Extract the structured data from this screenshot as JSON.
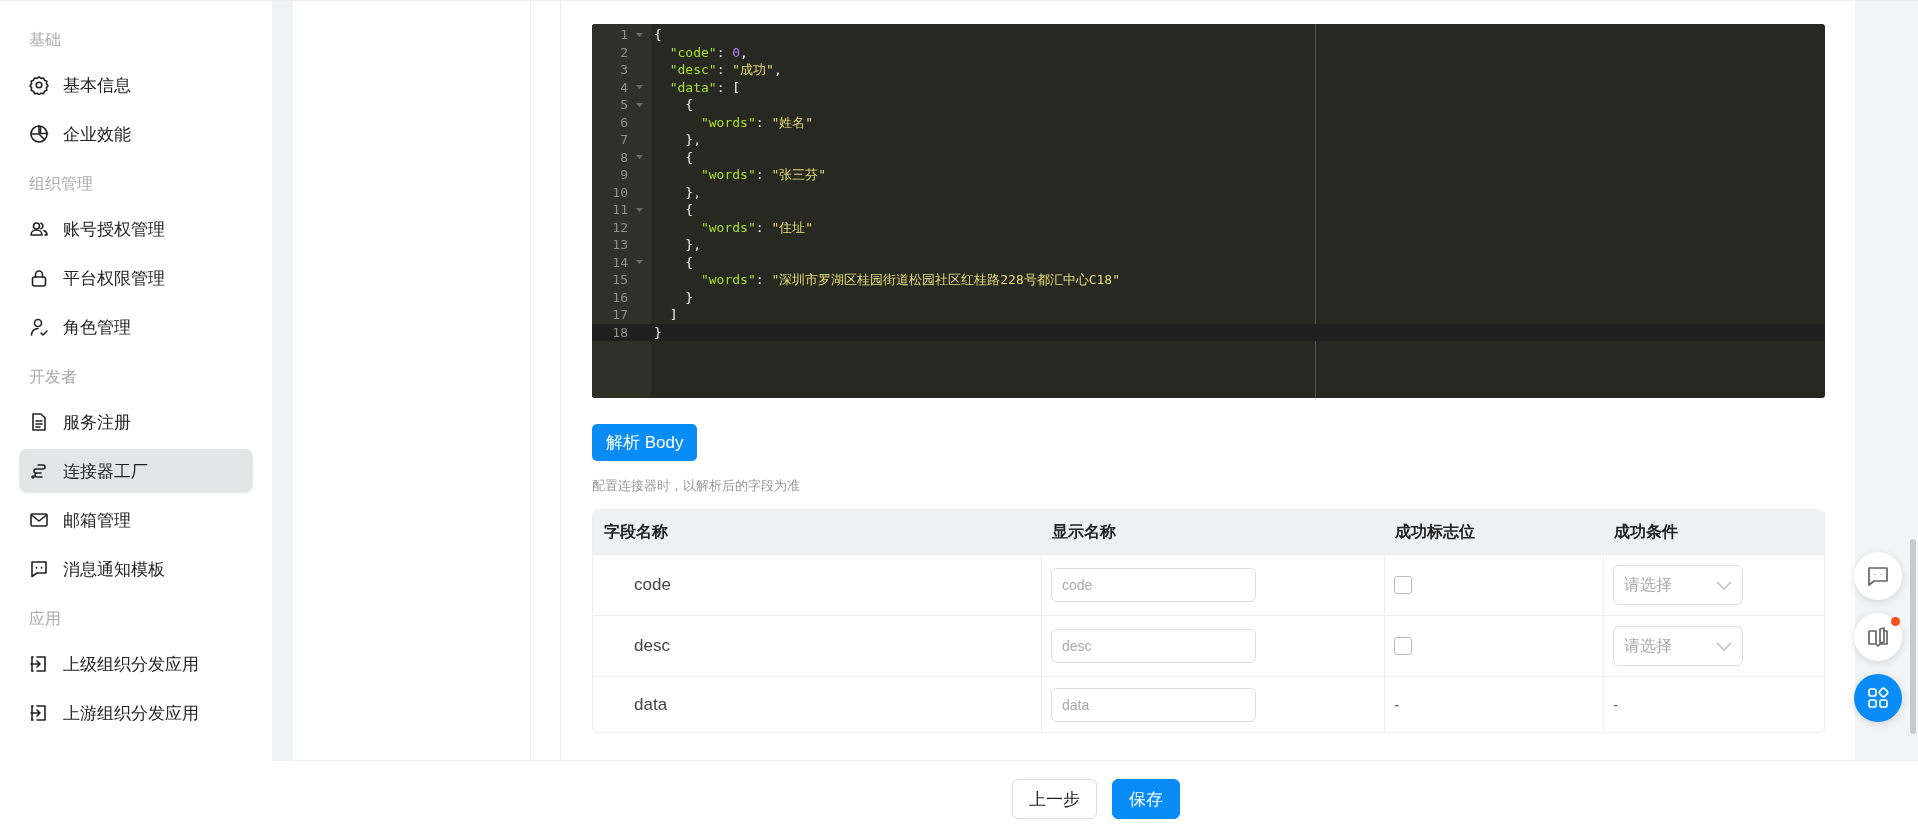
{
  "sidebar": {
    "groups": [
      {
        "heading": "基础",
        "items": [
          {
            "label": "基本信息",
            "selected": false
          },
          {
            "label": "企业效能",
            "selected": false
          }
        ]
      },
      {
        "heading": "组织管理",
        "items": [
          {
            "label": "账号授权管理",
            "selected": false
          },
          {
            "label": "平台权限管理",
            "selected": false
          },
          {
            "label": "角色管理",
            "selected": false
          }
        ]
      },
      {
        "heading": "开发者",
        "items": [
          {
            "label": "服务注册",
            "selected": false
          },
          {
            "label": "连接器工厂",
            "selected": true
          },
          {
            "label": "邮箱管理",
            "selected": false
          },
          {
            "label": "消息通知模板",
            "selected": false
          }
        ]
      },
      {
        "heading": "应用",
        "items": [
          {
            "label": "上级组织分发应用",
            "selected": false
          },
          {
            "label": "上游组织分发应用",
            "selected": false
          }
        ]
      }
    ]
  },
  "editor": {
    "lines": [
      {
        "number": "1",
        "foldable": true,
        "active": false,
        "tokens": [
          {
            "kind": "punct",
            "text": "{"
          }
        ]
      },
      {
        "number": "2",
        "foldable": false,
        "active": false,
        "tokens": [
          {
            "kind": "key",
            "text": "  \"code\""
          },
          {
            "kind": "punct",
            "text": ": "
          },
          {
            "kind": "number",
            "text": "0"
          },
          {
            "kind": "punct",
            "text": ","
          }
        ]
      },
      {
        "number": "3",
        "foldable": false,
        "active": false,
        "tokens": [
          {
            "kind": "key",
            "text": "  \"desc\""
          },
          {
            "kind": "punct",
            "text": ": "
          },
          {
            "kind": "string",
            "text": "\"成功\""
          },
          {
            "kind": "punct",
            "text": ","
          }
        ]
      },
      {
        "number": "4",
        "foldable": true,
        "active": false,
        "tokens": [
          {
            "kind": "key",
            "text": "  \"data\""
          },
          {
            "kind": "punct",
            "text": ": ["
          }
        ]
      },
      {
        "number": "5",
        "foldable": true,
        "active": false,
        "tokens": [
          {
            "kind": "punct",
            "text": "    {"
          }
        ]
      },
      {
        "number": "6",
        "foldable": false,
        "active": false,
        "tokens": [
          {
            "kind": "key",
            "text": "      \"words\""
          },
          {
            "kind": "punct",
            "text": ": "
          },
          {
            "kind": "string",
            "text": "\"姓名\""
          }
        ]
      },
      {
        "number": "7",
        "foldable": false,
        "active": false,
        "tokens": [
          {
            "kind": "punct",
            "text": "    },"
          }
        ]
      },
      {
        "number": "8",
        "foldable": true,
        "active": false,
        "tokens": [
          {
            "kind": "punct",
            "text": "    {"
          }
        ]
      },
      {
        "number": "9",
        "foldable": false,
        "active": false,
        "tokens": [
          {
            "kind": "key",
            "text": "      \"words\""
          },
          {
            "kind": "punct",
            "text": ": "
          },
          {
            "kind": "string",
            "text": "\"张三芬\""
          }
        ]
      },
      {
        "number": "10",
        "foldable": false,
        "active": false,
        "tokens": [
          {
            "kind": "punct",
            "text": "    },"
          }
        ]
      },
      {
        "number": "11",
        "foldable": true,
        "active": false,
        "tokens": [
          {
            "kind": "punct",
            "text": "    {"
          }
        ]
      },
      {
        "number": "12",
        "foldable": false,
        "active": false,
        "tokens": [
          {
            "kind": "key",
            "text": "      \"words\""
          },
          {
            "kind": "punct",
            "text": ": "
          },
          {
            "kind": "string",
            "text": "\"住址\""
          }
        ]
      },
      {
        "number": "13",
        "foldable": false,
        "active": false,
        "tokens": [
          {
            "kind": "punct",
            "text": "    },"
          }
        ]
      },
      {
        "number": "14",
        "foldable": true,
        "active": false,
        "tokens": [
          {
            "kind": "punct",
            "text": "    {"
          }
        ]
      },
      {
        "number": "15",
        "foldable": false,
        "active": false,
        "tokens": [
          {
            "kind": "key",
            "text": "      \"words\""
          },
          {
            "kind": "punct",
            "text": ": "
          },
          {
            "kind": "string",
            "text": "\"深圳市罗湖区桂园街道松园社区红桂路228号都汇中心C18\""
          }
        ]
      },
      {
        "number": "16",
        "foldable": false,
        "active": false,
        "tokens": [
          {
            "kind": "punct",
            "text": "    }"
          }
        ]
      },
      {
        "number": "17",
        "foldable": false,
        "active": false,
        "tokens": [
          {
            "kind": "punct",
            "text": "  ]"
          }
        ]
      },
      {
        "number": "18",
        "foldable": false,
        "active": true,
        "tokens": [
          {
            "kind": "punct",
            "text": "}"
          }
        ]
      }
    ]
  },
  "parse_button": "解析 Body",
  "hint": "配置连接器时，以解析后的字段为准",
  "table": {
    "columns": [
      "字段名称",
      "显示名称",
      "成功标志位",
      "成功条件"
    ],
    "rows": [
      {
        "field": "code",
        "display_placeholder": "code",
        "flag": {
          "kind": "checkbox",
          "checked": false
        },
        "condition": {
          "kind": "select",
          "placeholder": "请选择"
        }
      },
      {
        "field": "desc",
        "display_placeholder": "desc",
        "flag": {
          "kind": "checkbox",
          "checked": false
        },
        "condition": {
          "kind": "select",
          "placeholder": "请选择"
        }
      },
      {
        "field": "data",
        "display_placeholder": "data",
        "flag": {
          "kind": "text",
          "text": "-"
        },
        "condition": {
          "kind": "text",
          "text": "-"
        }
      }
    ]
  },
  "floating_buttons": [
    {
      "badge": false,
      "selected": false
    },
    {
      "badge": true,
      "selected": false
    },
    {
      "badge": false,
      "selected": true
    }
  ],
  "footer_buttons": [
    {
      "label": "上一步",
      "primary": false
    },
    {
      "label": "保存",
      "primary": true
    }
  ]
}
